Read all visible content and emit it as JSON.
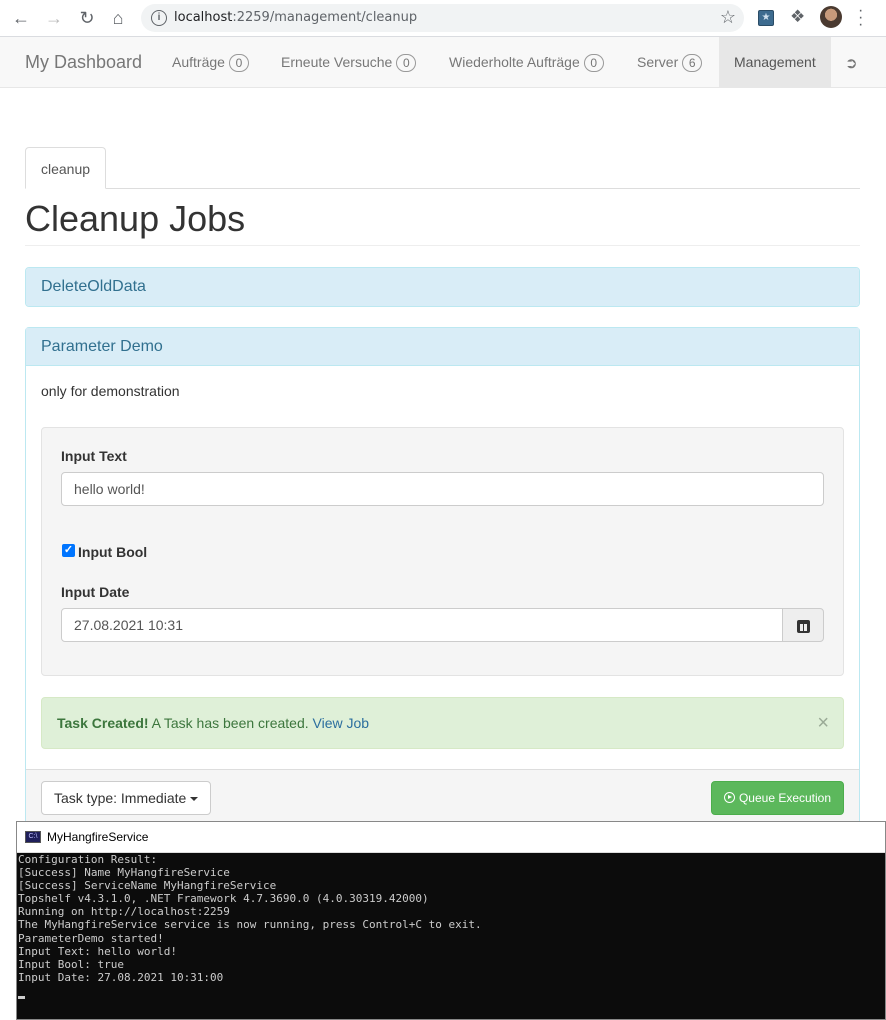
{
  "browser": {
    "url_host": "localhost",
    "url_rest": ":2259/management/cleanup"
  },
  "navbar": {
    "brand": "My Dashboard",
    "items": [
      {
        "label": "Aufträge",
        "count": "0"
      },
      {
        "label": "Erneute Versuche",
        "count": "0"
      },
      {
        "label": "Wiederholte Aufträge",
        "count": "0"
      },
      {
        "label": "Server",
        "count": "6"
      }
    ],
    "active": "Management"
  },
  "tab": {
    "label": "cleanup"
  },
  "page": {
    "title": "Cleanup Jobs"
  },
  "panels": {
    "delete_old_data": {
      "heading": "DeleteOldData"
    },
    "parameter_demo": {
      "heading": "Parameter Demo",
      "description": "only for demonstration",
      "input_text_label": "Input Text",
      "input_text_value": "hello world!",
      "input_bool_label": "Input Bool",
      "input_bool_checked": true,
      "input_date_label": "Input Date",
      "input_date_value": "27.08.2021 10:31"
    }
  },
  "alert": {
    "strong": "Task Created!",
    "text": " A Task has been created. ",
    "link": "View Job",
    "close": "×"
  },
  "footer": {
    "task_type_label": "Task type: Immediate",
    "queue_button": "Queue Execution"
  },
  "console": {
    "title": "MyHangfireService",
    "icon_text": "C:\\",
    "lines": [
      "Configuration Result:",
      "[Success] Name MyHangfireService",
      "[Success] ServiceName MyHangfireService",
      "Topshelf v4.3.1.0, .NET Framework 4.7.3690.0 (4.0.30319.42000)",
      "Running on http://localhost:2259",
      "The MyHangfireService service is now running, press Control+C to exit.",
      "ParameterDemo started!",
      "Input Text: hello world!",
      "Input Bool: true",
      "Input Date: 27.08.2021 10:31:00"
    ]
  }
}
